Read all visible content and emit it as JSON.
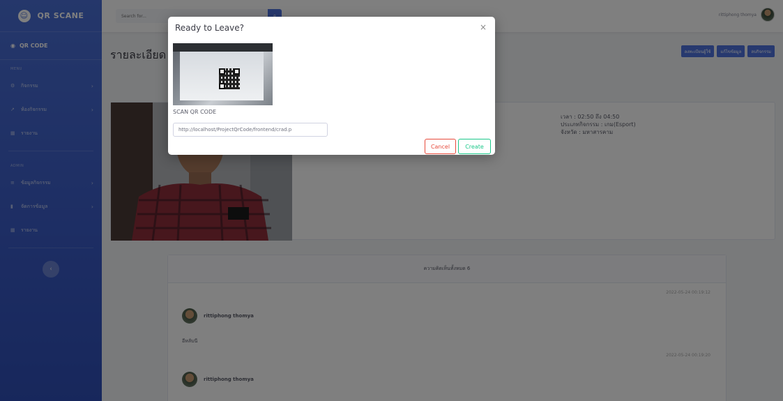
{
  "brand": {
    "name": "QR SCANE",
    "icon": "smile-icon"
  },
  "sidebar": {
    "active": "QR CODE",
    "menu_heading": "MENU",
    "menu": [
      {
        "label": "กิจกรรม",
        "icon": "gear-icon"
      },
      {
        "label": "ห้องกิจกรรม",
        "icon": "wrench-icon"
      },
      {
        "label": "รายงาน",
        "icon": "table-icon"
      }
    ],
    "admin_heading": "ADMIN",
    "admin": [
      {
        "label": "ข้อมูลกิจกรรม",
        "icon": "list-icon"
      },
      {
        "label": "จัดการข้อมูล",
        "icon": "chart-icon"
      },
      {
        "label": "รายงาน",
        "icon": "table-icon"
      }
    ]
  },
  "topbar": {
    "search_placeholder": "Search for...",
    "user_name": "rittiphong thomya"
  },
  "page": {
    "title": "รายละเอียด",
    "buttons": [
      "ลงทะเบียนผู้ใช้",
      "แก้ไขข้อมูล",
      "ลบกิจกรรม"
    ]
  },
  "detail": {
    "time": "เวลา : 02:50 ถึง 04:50",
    "type": "ประเภทกิจกรรม : เกม(Esport)",
    "province": "จังหวัด : มหาสารคาม"
  },
  "comments": {
    "header": "ความคิดเห็นทั้งหมด 6",
    "items": [
      {
        "time": "2022-05-24 00:19:12",
        "user": "rittiphong thomya",
        "text": "อีหลับนี"
      },
      {
        "time": "2022-05-24 00:19:20",
        "user": "rittiphong thomya",
        "text": ""
      }
    ]
  },
  "modal": {
    "title": "Ready to Leave?",
    "scan_label": "SCAN QR CODE",
    "url_value": "http://localhost/ProjectQrCode/frontend/crad.p",
    "cancel_label": "Cancel",
    "create_label": "Create"
  }
}
